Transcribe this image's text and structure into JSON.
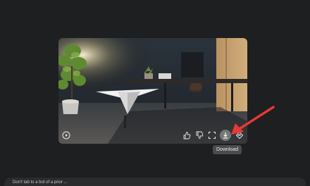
{
  "tooltip": {
    "download": "Download"
  },
  "controls": {
    "play": "play-icon",
    "like": "thumbs-up-icon",
    "dislike": "thumbs-down-icon",
    "fullscreen": "fullscreen-icon",
    "download": "download-icon",
    "share": "share-icon"
  },
  "bottom_bar": {
    "text": "Don't tab to a bot of a prior ... "
  },
  "colors": {
    "arrow": "#e53935",
    "background": "#1e1f20"
  }
}
